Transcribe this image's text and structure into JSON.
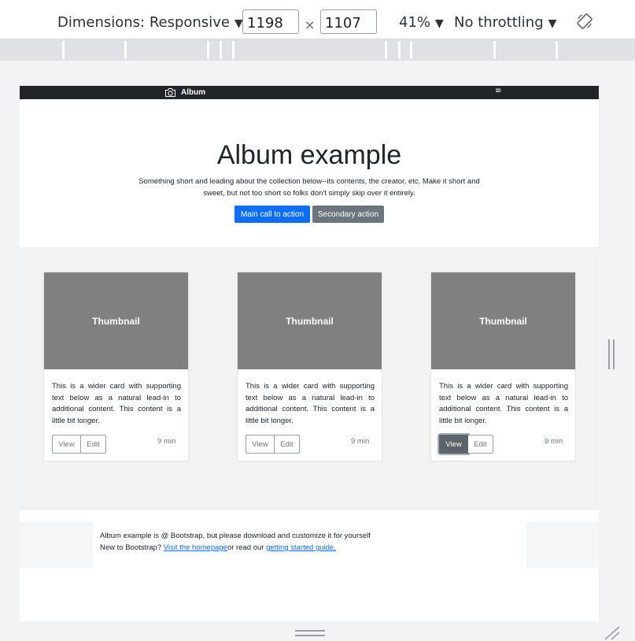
{
  "devtools": {
    "dimensions_label": "Dimensions: Responsive",
    "width_value": "1198",
    "times": "×",
    "height_value": "1107",
    "zoom": "41%",
    "throttling": "No throttling",
    "caret": "▼",
    "rotate_icon": "rotate-icon"
  },
  "page": {
    "brand": "Album",
    "brand_icon": "camera-icon",
    "menu_icon": "≡",
    "hero": {
      "title": "Album example",
      "lead": "Something short and leading about the collection below--its contents, the creator, etc. Make it short and sweet, but not too short so folks don't simply skip over it entirely.",
      "primary_button": "Main call to action",
      "secondary_button": "Secondary action"
    },
    "cards": [
      {
        "thumbnail": "Thumbnail",
        "text": "This is a wider card with supporting text below as a natural lead-in to additional content. This content is a little bit longer.",
        "view": "View",
        "edit": "Edit",
        "minutes": "9 min"
      },
      {
        "thumbnail": "Thumbnail",
        "text": "This is a wider card with supporting text below as a natural lead-in to additional content. This content is a little bit longer.",
        "view": "View",
        "edit": "Edit",
        "minutes": "9 min"
      },
      {
        "thumbnail": "Thumbnail",
        "text": "This is a wider card with supporting text below as a natural lead-in to additional content. This content is a little bit longer.",
        "view": "View",
        "edit": "Edit",
        "minutes": "9 min"
      }
    ],
    "footer": {
      "line1": "Album example is @ Bootstrap, but please download and customize it for yourself",
      "line2_prefix": "New to Bootstrap? ",
      "homepage_link": "Visit the homepage",
      "line2_middle": "or read our ",
      "guide_link": "getting started guide."
    }
  },
  "colors": {
    "navbar": "#212529",
    "primary": "#0d6efd",
    "secondary": "#6c757d",
    "thumbnail": "#808080"
  }
}
